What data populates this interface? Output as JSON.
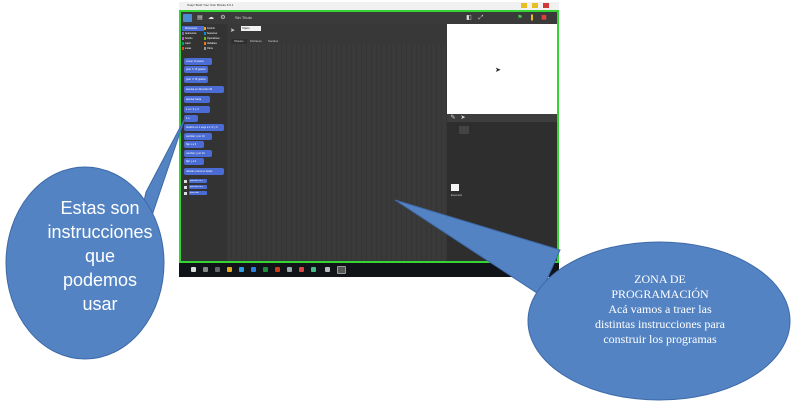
{
  "window": {
    "title": "Snap! Build Your Own Blocks 6.6.1"
  },
  "project": {
    "title": "Sin Título"
  },
  "palette": {
    "categories": [
      {
        "label": "Movimiento",
        "color": "#4a6cd4"
      },
      {
        "label": "Control",
        "color": "#e6a822"
      },
      {
        "label": "Apariencia",
        "color": "#8a55d7"
      },
      {
        "label": "Sensores",
        "color": "#0494dc"
      },
      {
        "label": "Sonido",
        "color": "#cf4ad9"
      },
      {
        "label": "Operadores",
        "color": "#62c213"
      },
      {
        "label": "Lápiz",
        "color": "#00a178"
      },
      {
        "label": "Variables",
        "color": "#f3761d"
      },
      {
        "label": "Listas",
        "color": "#d94d11"
      },
      {
        "label": "Otros",
        "color": "#969696"
      }
    ],
    "blocks": [
      "mover 10 pasos",
      "girar ↻ 15 grados",
      "girar ↺ 15 grados",
      "apuntar en dirección 90",
      "apuntar hacia",
      "ir a x: 0 y: 0",
      "ir a",
      "deslizar en 1 segs a x: 0 y: 0",
      "cambiar x por 10",
      "fijar x a 0",
      "cambiar y por 10",
      "fijar y a 0",
      "rebotar si toca un borde"
    ],
    "reporters": [
      "posición en x",
      "posición en y",
      "dirección"
    ]
  },
  "sprite": {
    "name": "Objeto"
  },
  "tabs": [
    "Objetos",
    "Disfraces",
    "Sonidos"
  ],
  "stage_label": "Escenario",
  "callouts": {
    "left": [
      "Estas son",
      "instrucciones",
      "que",
      "podemos",
      "usar"
    ],
    "right": [
      "ZONA DE",
      "PROGRAMACIÓN",
      "Acá vamos a traer las",
      "distintas instrucciones para",
      "construir los programas"
    ]
  },
  "colors": {
    "bubble": "#5383c3",
    "bubble_border": "#3e6aa8",
    "app_border": "#35d435",
    "block": "#4a6cd4"
  }
}
